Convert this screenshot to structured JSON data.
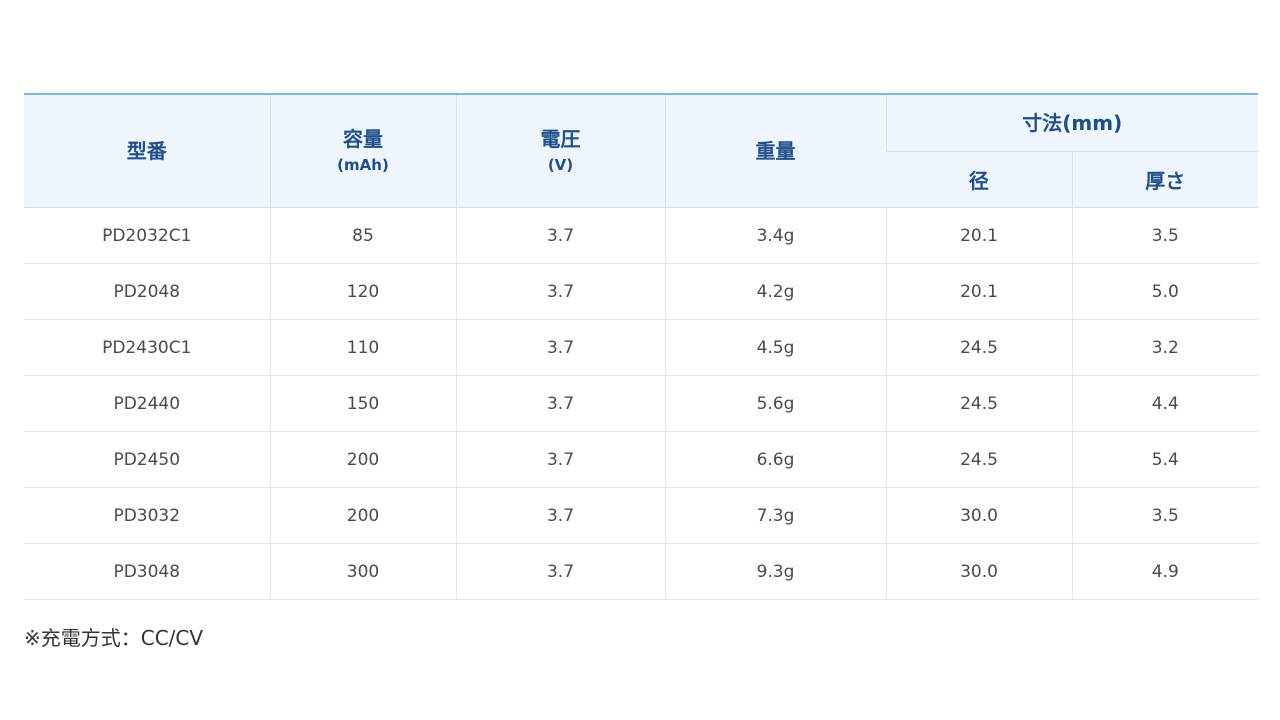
{
  "table": {
    "headers": {
      "model": "型番",
      "capacity": "容量",
      "capacity_unit": "(mAh)",
      "voltage": "電圧",
      "voltage_unit": "(V)",
      "weight": "重量",
      "dimensions": "寸法(mm)",
      "diameter": "径",
      "thickness": "厚さ"
    },
    "rows": [
      [
        "PD2032C1",
        "85",
        "3.7",
        "3.4g",
        "20.1",
        "3.5"
      ],
      [
        "PD2048",
        "120",
        "3.7",
        "4.2g",
        "20.1",
        "5.0"
      ],
      [
        "PD2430C1",
        "110",
        "3.7",
        "4.5g",
        "24.5",
        "3.2"
      ],
      [
        "PD2440",
        "150",
        "3.7",
        "5.6g",
        "24.5",
        "4.4"
      ],
      [
        "PD2450",
        "200",
        "3.7",
        "6.6g",
        "24.5",
        "5.4"
      ],
      [
        "PD3032",
        "200",
        "3.7",
        "7.3g",
        "30.0",
        "3.5"
      ],
      [
        "PD3048",
        "300",
        "3.7",
        "9.3g",
        "30.0",
        "4.9"
      ]
    ]
  },
  "note": "※充電方式：CC/CV",
  "colors": {
    "header_bg": "#eef5fd",
    "header_text": "#1f4f8a",
    "top_border": "#87b4e0"
  }
}
